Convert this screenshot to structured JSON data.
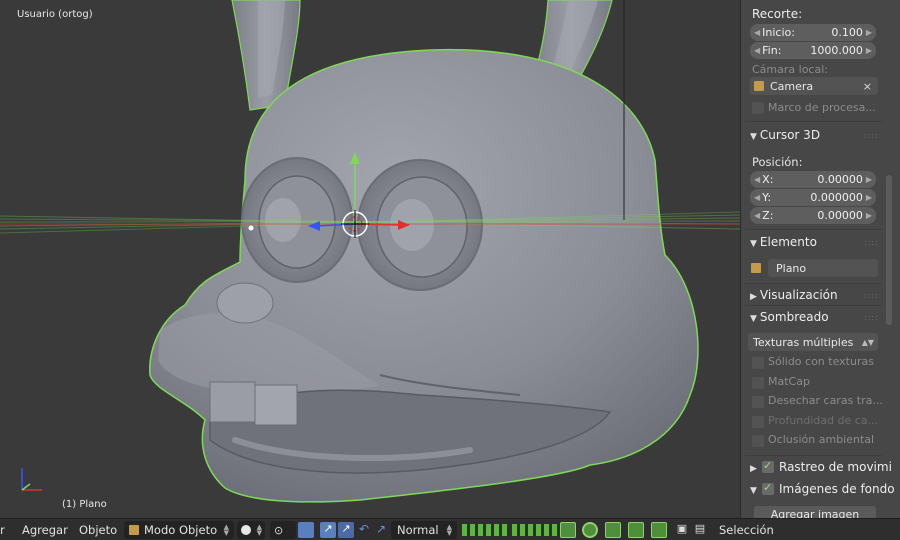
{
  "viewport": {
    "view_label": "Usuario (ortog)",
    "object_label": "(1) Plano",
    "colors": {
      "outline": "#7ed957",
      "mesh": "#8a8c96",
      "axis_x": "#e03030",
      "axis_y": "#7ed957",
      "axis_z": "#3355ff"
    }
  },
  "panel": {
    "recorte_title": "Recorte:",
    "inicio_label": "Inicio:",
    "inicio_value": "0.100",
    "fin_label": "Fin:",
    "fin_value": "1000.000",
    "camara_local_label": "Cámara local:",
    "camera_name": "Camera",
    "clear_symbol": "×",
    "marco_label": "Marco de procesa...",
    "cursor3d_title": "Cursor 3D",
    "posicion_label": "Posición:",
    "x_label": "X:",
    "x_value": "0.00000",
    "y_label": "Y:",
    "y_value": "0.000000",
    "z_label": "Z:",
    "z_value": "0.00000",
    "elemento_title": "Elemento",
    "element_name": "Plano",
    "visualizacion_title": "Visualización",
    "sombreado_title": "Sombreado",
    "texturas_value": "Texturas múltiples",
    "solido_label": "Sólido con texturas",
    "matcap_label": "MatCap",
    "desechar_label": "Desechar caras tra...",
    "profundidad_label": "Profundidad de ca...",
    "oclusion_label": "Oclusión ambiental",
    "rastreo_title": "Rastreo de movimi",
    "imagenes_title": "Imágenes de fondo",
    "agregar_imagen_label": "Agregar imagen"
  },
  "header": {
    "menu_partial": "r",
    "agregar_label": "Agregar",
    "objeto_label": "Objeto",
    "mode_label": "Modo Objeto",
    "pivot_label": "Normal",
    "seleccion_label": "Selección",
    "icons": [
      "mode-cube-icon",
      "shading-sphere-icon",
      "pivot-icon",
      "manipulator-icon",
      "translate-icon",
      "rotate-icon",
      "scale-icon",
      "layers-icon",
      "lock-icon",
      "snap-icon",
      "proportional-icon",
      "render-icon",
      "camera-icon"
    ]
  }
}
